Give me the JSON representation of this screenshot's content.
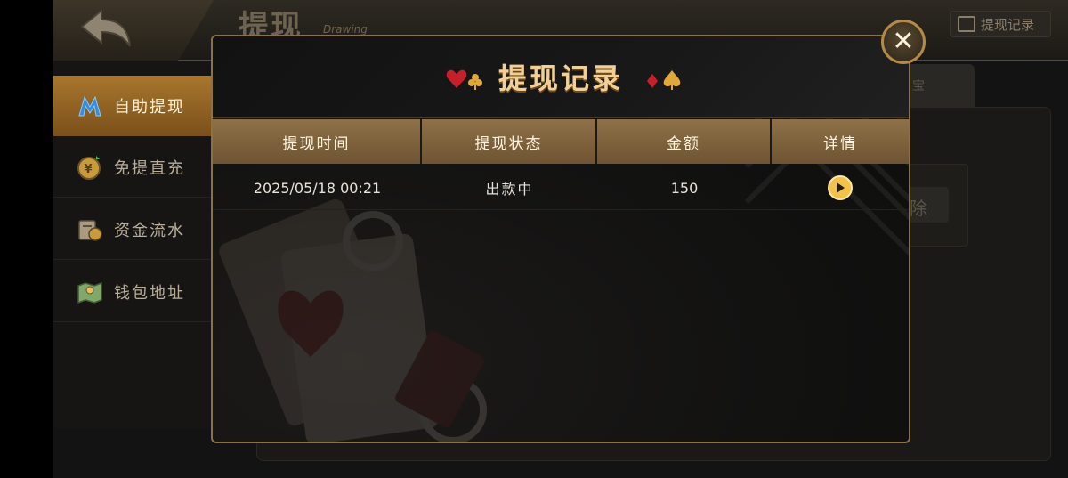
{
  "page": {
    "title": "提现",
    "subtitle": "Drawing",
    "history_button_label": "提现记录"
  },
  "sidebar": {
    "items": [
      {
        "label": "自助提现",
        "icon": "m-logo-icon",
        "active": true
      },
      {
        "label": "免提直充",
        "icon": "yuan-coin-icon",
        "active": false
      },
      {
        "label": "资金流水",
        "icon": "ledger-coin-icon",
        "active": false
      },
      {
        "label": "钱包地址",
        "icon": "wallet-map-icon",
        "active": false
      }
    ]
  },
  "background": {
    "tab_label": "宝",
    "delete_label": "除"
  },
  "modal": {
    "title": "提现记录",
    "columns": [
      "提现时间",
      "提现状态",
      "金额",
      "详情"
    ],
    "rows": [
      {
        "time": "2025/05/18 00:21",
        "status": "出款中",
        "amount": "150",
        "detail_icon": "arrow-right-circle-icon"
      }
    ],
    "close_icon": "close-icon"
  },
  "colors": {
    "accent_gold": "#f1cf95",
    "header_brown": "#8e7148",
    "active_tab": "#a8762e",
    "suit_red": "#c8202a",
    "suit_gold": "#e0a83a"
  }
}
